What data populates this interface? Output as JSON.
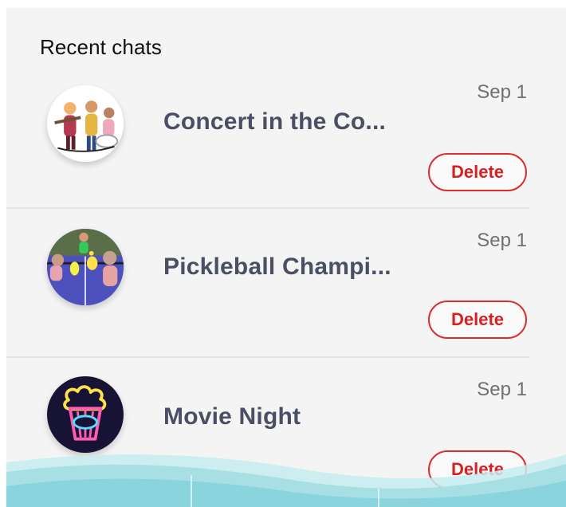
{
  "section_title": "Recent chats",
  "chats": [
    {
      "title": "Concert in the Co...",
      "date": "Sep 1",
      "delete_label": "Delete",
      "avatar_icon": "concert-image"
    },
    {
      "title": "Pickleball Champi...",
      "date": "Sep 1",
      "delete_label": "Delete",
      "avatar_icon": "pickleball-image"
    },
    {
      "title": "Movie Night",
      "date": "Sep 1",
      "delete_label": "Delete",
      "avatar_icon": "popcorn-icon"
    }
  ],
  "colors": {
    "background": "#f4f4f4",
    "title_text": "#4a4f63",
    "date_text": "#707070",
    "delete_red": "#d82021",
    "divider": "#dde4ea",
    "wave": "#a8dfe4"
  }
}
